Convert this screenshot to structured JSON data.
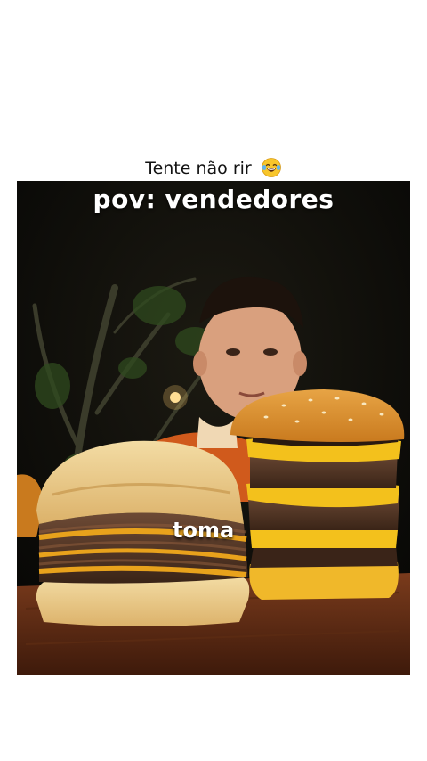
{
  "post": {
    "caption_text": "Tente não rir",
    "caption_emoji": "laughing-tears-emoji"
  },
  "video": {
    "top_overlay": "pov: vendedores",
    "bottom_overlay": "toma"
  }
}
